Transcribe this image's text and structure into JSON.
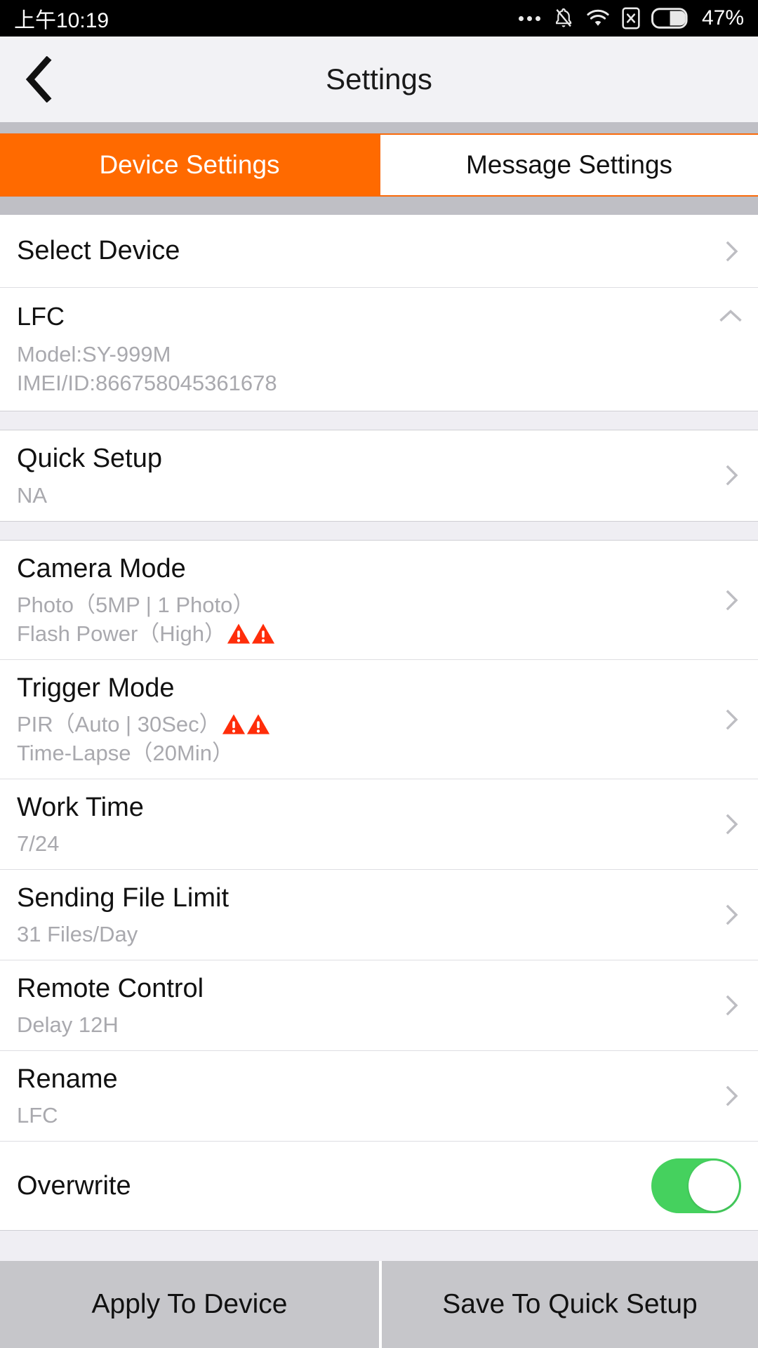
{
  "status_bar": {
    "time": "上午10:19",
    "icons": [
      "more-dots-icon",
      "bell-muted-icon",
      "wifi-icon",
      "sim-card-x-icon",
      "battery-icon"
    ],
    "battery_percent": "47%"
  },
  "header": {
    "back_icon": "chevron-left-icon",
    "title": "Settings"
  },
  "tabs": [
    {
      "label": "Device Settings",
      "active": true
    },
    {
      "label": "Message Settings",
      "active": false
    }
  ],
  "colors": {
    "accent_orange": "#FF6A00",
    "warning_red": "#FF2D0A",
    "toggle_green": "#45D15E",
    "section_gap": "#EFEEF3",
    "button_gray": "#C6C6CA"
  },
  "sections": {
    "select_device": {
      "title": "Select Device",
      "chevron": "chevron-right-icon"
    },
    "device_card": {
      "name": "LFC",
      "model": "Model:SY-999M",
      "imei": "IMEI/ID:866758045361678",
      "chevron": "chevron-up-icon"
    },
    "quick_setup": {
      "title": "Quick Setup",
      "value": "NA",
      "chevron": "chevron-right-icon"
    },
    "camera_mode": {
      "title": "Camera Mode",
      "line1": "Photo（5MP | 1 Photo）",
      "line2": "Flash Power（High）",
      "line2_warnings": 2,
      "chevron": "chevron-right-icon"
    },
    "trigger_mode": {
      "title": "Trigger Mode",
      "line1": "PIR（Auto | 30Sec）",
      "line1_warnings": 2,
      "line2": "Time-Lapse（20Min）",
      "chevron": "chevron-right-icon"
    },
    "work_time": {
      "title": "Work Time",
      "value": "7/24",
      "chevron": "chevron-right-icon"
    },
    "sending_file_limit": {
      "title": "Sending File Limit",
      "value": "31 Files/Day",
      "chevron": "chevron-right-icon"
    },
    "remote_control": {
      "title": "Remote Control",
      "value": "Delay 12H",
      "chevron": "chevron-right-icon"
    },
    "rename": {
      "title": "Rename",
      "value": "LFC",
      "chevron": "chevron-right-icon"
    },
    "overwrite": {
      "title": "Overwrite",
      "toggle_on": true
    }
  },
  "bottom_bar": {
    "apply_label": "Apply To Device",
    "save_label": "Save To Quick Setup"
  }
}
